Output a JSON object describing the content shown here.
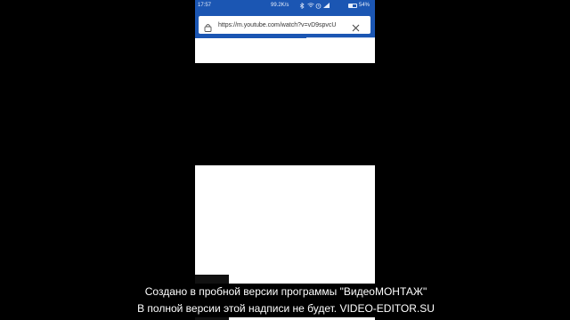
{
  "status_bar": {
    "time": "17:57",
    "speed": "99.2K/s",
    "battery_percent_label": "54%",
    "battery_level": 0.54,
    "icons": [
      "bluetooth-icon",
      "wifi-icon",
      "alarm-icon",
      "signal-icon"
    ]
  },
  "browser": {
    "url": "https://m.youtube.com/watch?v=vD9spvcU",
    "page_load_progress": 0.62
  },
  "colors": {
    "toolbar": "#1b56b3",
    "page": "#ffffff",
    "background": "#000000"
  },
  "watermark": {
    "line1": "Создано в пробной версии программы \"ВидеоМОНТАЖ\"",
    "line2": "В полной версии этой надписи не будет. VIDEO-EDITOR.SU"
  }
}
